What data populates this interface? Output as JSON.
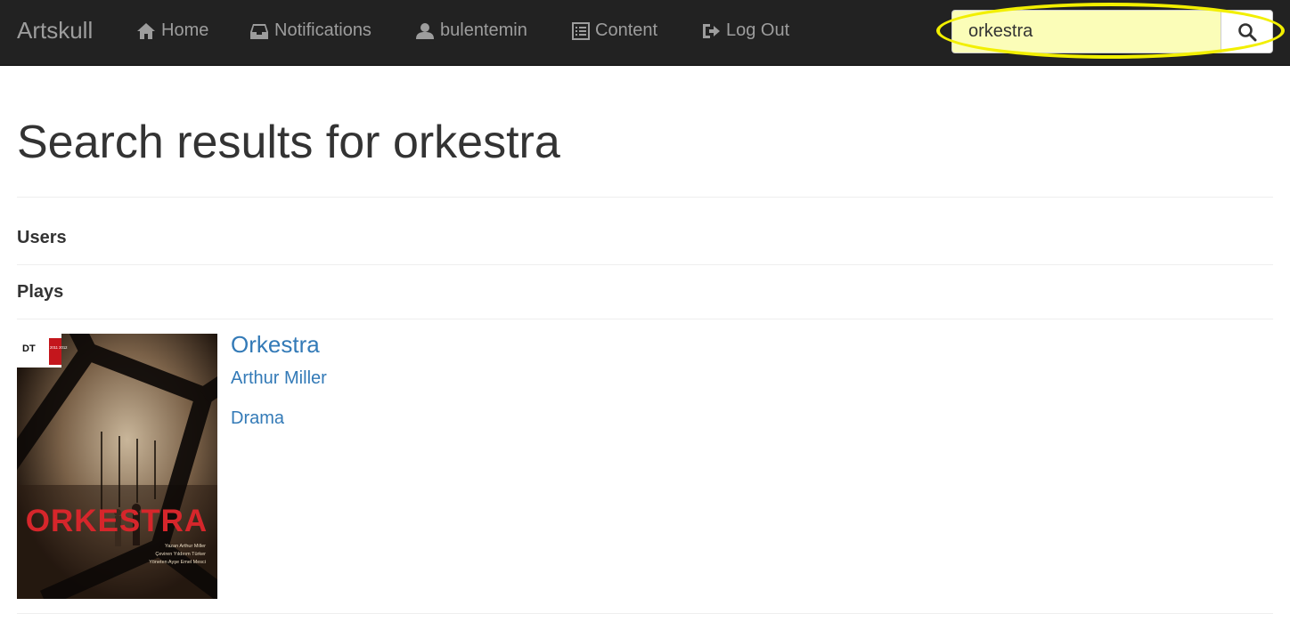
{
  "navbar": {
    "brand": "Artskull",
    "items": [
      {
        "label": "Home",
        "icon": "home-icon"
      },
      {
        "label": "Notifications",
        "icon": "inbox-icon"
      },
      {
        "label": "bulentemin",
        "icon": "user-icon"
      },
      {
        "label": "Content",
        "icon": "list-alt-icon"
      },
      {
        "label": "Log Out",
        "icon": "log-out-icon"
      }
    ],
    "search": {
      "value": "orkestra",
      "button_icon": "search-icon"
    }
  },
  "main": {
    "title": "Search results for orkestra",
    "sections": {
      "users": "Users",
      "plays": "Plays"
    },
    "results": [
      {
        "title": "Orkestra",
        "author": "Arthur Miller",
        "genre": "Drama",
        "poster": {
          "title_text": "ORKESTRA",
          "credits": [
            "Yazan Arthur Miller",
            "Çeviren Yıldırım Türker",
            "Yöneten Ayşe Emel Mesci"
          ],
          "badge": "DT",
          "season": "2011 2012"
        }
      }
    ]
  },
  "colors": {
    "navbar_bg": "#222222",
    "nav_text": "#9d9d9d",
    "link": "#337ab7",
    "search_bg": "#fbfdb8",
    "highlight": "#f2ef00"
  }
}
